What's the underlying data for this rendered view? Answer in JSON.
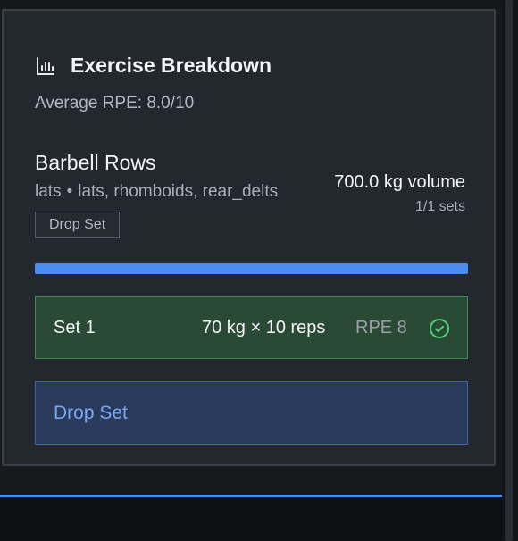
{
  "card": {
    "title": "Exercise Breakdown",
    "title_icon": "bar-chart-icon",
    "average_rpe": "Average RPE: 8.0/10"
  },
  "exercise": {
    "name": "Barbell Rows",
    "primary_muscle": "lats",
    "separator": "•",
    "secondary_muscles": "lats, rhomboids, rear_delts",
    "volume": "700.0 kg volume",
    "sets_count": "1/1 sets",
    "tag": "Drop Set",
    "progress": 1.0
  },
  "sets": [
    {
      "label": "Set 1",
      "weight_reps": "70 kg × 10 reps",
      "rpe": "RPE 8",
      "status_icon": "check-circle-icon"
    }
  ],
  "drop_set_button": "Drop Set",
  "colors": {
    "accent": "#4a8cf0",
    "complete_bg": "#2b4a35",
    "complete_border": "#3f8a4f",
    "check": "#4fd07a"
  }
}
